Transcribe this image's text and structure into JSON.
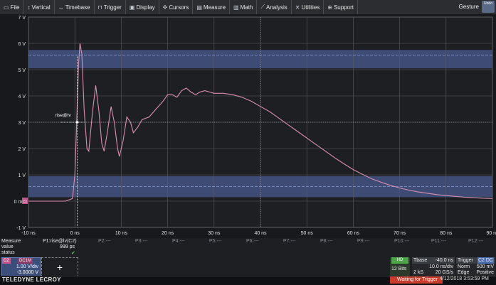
{
  "menu": {
    "items": [
      {
        "icon": "file-icon",
        "glyph": "▭",
        "label": "File"
      },
      {
        "icon": "vertical-icon",
        "glyph": "↕",
        "label": "Vertical"
      },
      {
        "icon": "timebase-icon",
        "glyph": "↔",
        "label": "Timebase"
      },
      {
        "icon": "trigger-icon",
        "glyph": "⊓",
        "label": "Trigger"
      },
      {
        "icon": "display-icon",
        "glyph": "▣",
        "label": "Display"
      },
      {
        "icon": "cursors-icon",
        "glyph": "✣",
        "label": "Cursors"
      },
      {
        "icon": "measure-icon",
        "glyph": "▤",
        "label": "Measure"
      },
      {
        "icon": "math-icon",
        "glyph": "▥",
        "label": "Math"
      },
      {
        "icon": "analysis-icon",
        "glyph": "⟋",
        "label": "Analysis"
      },
      {
        "icon": "utilities-icon",
        "glyph": "✕",
        "label": "Utilities"
      },
      {
        "icon": "support-icon",
        "glyph": "⊕",
        "label": "Support"
      }
    ],
    "gesture": "Gesture",
    "undo": "Undo"
  },
  "plot": {
    "colors": {
      "background": "#1e1f23",
      "grid": "#5a5a60",
      "trace": "#d98fb0",
      "band": "#40507e",
      "ref": "#8da0d8"
    },
    "y_labels": [
      "7 V",
      "6 V",
      "5 V",
      "4 V",
      "3 V",
      "2 V",
      "1 V",
      "0 mV",
      "-1 V"
    ],
    "x_labels": [
      "-10 ns",
      "0 ns",
      "10 ns",
      "20 ns",
      "30 ns",
      "40 ns",
      "50 ns",
      "60 ns",
      "70 ns",
      "80 ns",
      "90 ns"
    ],
    "marker_label": "rise@lv",
    "ground_marker": "C2"
  },
  "chart_data": {
    "type": "line",
    "xlabel": "",
    "ylabel": "",
    "xlim": [
      -10,
      90
    ],
    "ylim": [
      -1,
      7
    ],
    "series": [
      {
        "points": [
          [
            -10,
            0
          ],
          [
            -2,
            0
          ],
          [
            -0.5,
            0.1
          ],
          [
            0,
            1
          ],
          [
            0.4,
            3
          ],
          [
            0.8,
            5.2
          ],
          [
            1.1,
            6
          ],
          [
            1.5,
            5.6
          ],
          [
            2,
            3.5
          ],
          [
            2.6,
            2
          ],
          [
            3,
            1.9
          ],
          [
            3.8,
            3.4
          ],
          [
            4.5,
            4.4
          ],
          [
            5.2,
            3.4
          ],
          [
            5.8,
            2.2
          ],
          [
            6.3,
            1.9
          ],
          [
            7,
            2.6
          ],
          [
            7.8,
            3.6
          ],
          [
            8.5,
            3
          ],
          [
            9.2,
            2
          ],
          [
            9.6,
            1.7
          ],
          [
            10.4,
            2.3
          ],
          [
            11.2,
            3.2
          ],
          [
            12,
            3
          ],
          [
            12.6,
            2.6
          ],
          [
            13.5,
            2.8
          ],
          [
            14.5,
            3.1
          ],
          [
            16,
            3.2
          ],
          [
            17.5,
            3.5
          ],
          [
            19,
            3.8
          ],
          [
            20,
            4.05
          ],
          [
            21,
            4.05
          ],
          [
            22,
            3.95
          ],
          [
            23,
            4.2
          ],
          [
            24,
            4.3
          ],
          [
            25,
            4.15
          ],
          [
            26,
            4.05
          ],
          [
            27,
            4.15
          ],
          [
            28,
            4.2
          ],
          [
            29,
            4.15
          ],
          [
            30,
            4.1
          ],
          [
            32,
            4.1
          ],
          [
            34,
            4.05
          ],
          [
            36,
            3.95
          ],
          [
            38,
            3.8
          ],
          [
            40,
            3.6
          ],
          [
            42,
            3.4
          ],
          [
            44,
            3.15
          ],
          [
            46,
            2.9
          ],
          [
            48,
            2.65
          ],
          [
            50,
            2.4
          ],
          [
            52,
            2.15
          ],
          [
            54,
            1.9
          ],
          [
            56,
            1.65
          ],
          [
            58,
            1.42
          ],
          [
            60,
            1.2
          ],
          [
            62,
            1.02
          ],
          [
            64,
            0.85
          ],
          [
            66,
            0.72
          ],
          [
            68,
            0.6
          ],
          [
            70,
            0.5
          ],
          [
            72,
            0.42
          ],
          [
            74,
            0.35
          ],
          [
            76,
            0.3
          ],
          [
            78,
            0.25
          ],
          [
            80,
            0.21
          ],
          [
            82,
            0.18
          ],
          [
            84,
            0.15
          ],
          [
            86,
            0.13
          ],
          [
            88,
            0.11
          ],
          [
            90,
            0.1
          ]
        ]
      }
    ],
    "bands": [
      [
        5.05,
        5.75
      ],
      [
        0.15,
        0.95
      ]
    ],
    "ref_lines": [
      0.55,
      5.55
    ],
    "marker": {
      "x": 0.5,
      "y": 3
    }
  },
  "measure": {
    "header": "Measure",
    "p1_label": "P1:rise@lv(C2)",
    "slots": [
      "P2:---",
      "P3:---",
      "P4:---",
      "P5:---",
      "P6:---",
      "P7:---",
      "P8:---",
      "P9:---",
      "P10:---",
      "P11:---",
      "P12:---"
    ],
    "row_value_label": "value",
    "row_status_label": "status",
    "p1_value": "999 ps",
    "p1_status": "✔"
  },
  "channel": {
    "tag1": "C2",
    "tag2": "DC1M",
    "scale": "1.00 V/div",
    "offset": "-3.0000 V",
    "add_symbol": "+"
  },
  "timebase": {
    "hd": "HD",
    "bits": "12 Bits",
    "label": "Tbase",
    "delay": "-40.0 ns",
    "time_div": "10.0 ns/div",
    "samples": "2 kS",
    "rate": "20 GS/s"
  },
  "trigger": {
    "label": "Trigger",
    "tags": "C2 DC",
    "mode": "Norm",
    "type": "Edge",
    "level": "500 mV",
    "slope": "Positive"
  },
  "status": {
    "brand": "TELEDYNE LECROY",
    "waiting": "Waiting for Trigger",
    "datetime": "4/12/2018 3:53:59 PM"
  }
}
